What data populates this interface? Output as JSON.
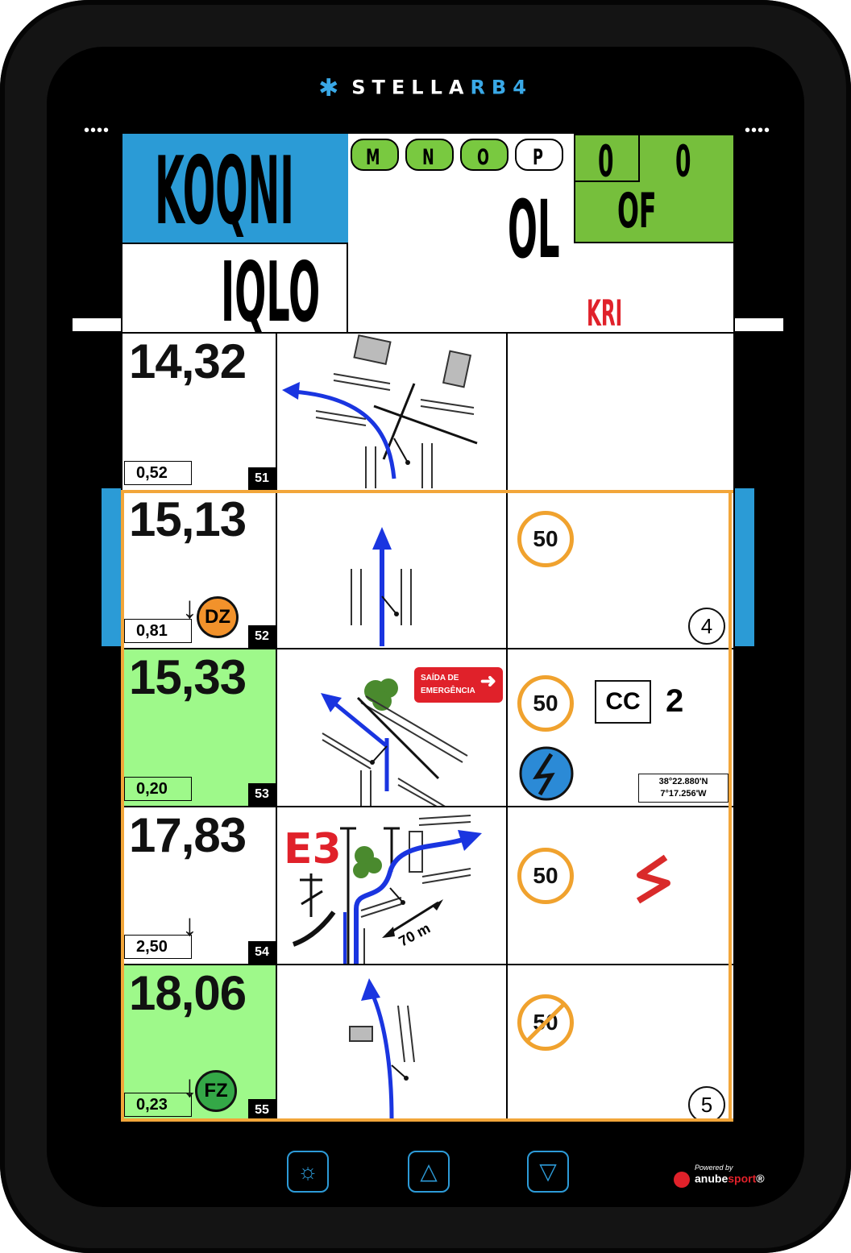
{
  "device": {
    "brand_prefix": "STELLA",
    "brand_suffix": "RB4",
    "left_dots": "••••",
    "right_dots": "••••",
    "powered_by": "Powered by",
    "powered_name_a": "anube",
    "powered_name_b": "sport",
    "powered_reg": "®"
  },
  "header": {
    "main_code": "KOQNI",
    "sub_code": "IQLO",
    "center_code": "OL",
    "red_code": "KRI",
    "pills": [
      {
        "label": "M",
        "active": true
      },
      {
        "label": "N",
        "active": true
      },
      {
        "label": "O",
        "active": true
      },
      {
        "label": "P",
        "active": false
      }
    ],
    "green_left": "0",
    "green_right": "0",
    "green_bottom": "OF"
  },
  "rows": [
    {
      "distance": "14,32",
      "partial": "0,52",
      "number": "51",
      "green": false,
      "zone": "",
      "arrow": false,
      "speed": "",
      "circle": "",
      "extras": []
    },
    {
      "distance": "15,13",
      "partial": "0,81",
      "number": "52",
      "green": false,
      "zone": "DZ",
      "arrow": true,
      "speed": "50",
      "circle": "4",
      "extras": []
    },
    {
      "distance": "15,33",
      "partial": "0,20",
      "number": "53",
      "green": true,
      "zone": "",
      "arrow": false,
      "speed": "50",
      "circle": "",
      "extras": [
        "cc"
      ]
    },
    {
      "distance": "17,83",
      "partial": "2,50",
      "number": "54",
      "green": false,
      "zone": "",
      "arrow": true,
      "speed": "50",
      "circle": "",
      "extras": []
    },
    {
      "distance": "18,06",
      "partial": "0,23",
      "number": "55",
      "green": true,
      "zone": "FZ",
      "arrow": true,
      "speed": "50",
      "circle": "5",
      "extras": []
    }
  ],
  "row53": {
    "exit_line1": "SAÍDA DE",
    "exit_line2": "EMERGÊNCIA",
    "cc_label": "CC",
    "cc_value": "2",
    "coords_line1": "38°22.880'N",
    "coords_line2": "7°17.256'W"
  },
  "row54": {
    "marker": "E3",
    "distance_label": "70 m"
  },
  "icons": {
    "brightness": "sun-icon",
    "up": "triangle-up-icon",
    "down": "triangle-down-icon"
  },
  "colors": {
    "accent_blue": "#2b9bd6",
    "pill_green": "#79c940",
    "box_green": "#76bf3c",
    "row_green": "#9ef98a",
    "speed_orange": "#f0a22e",
    "alert_red": "#e0212a"
  }
}
